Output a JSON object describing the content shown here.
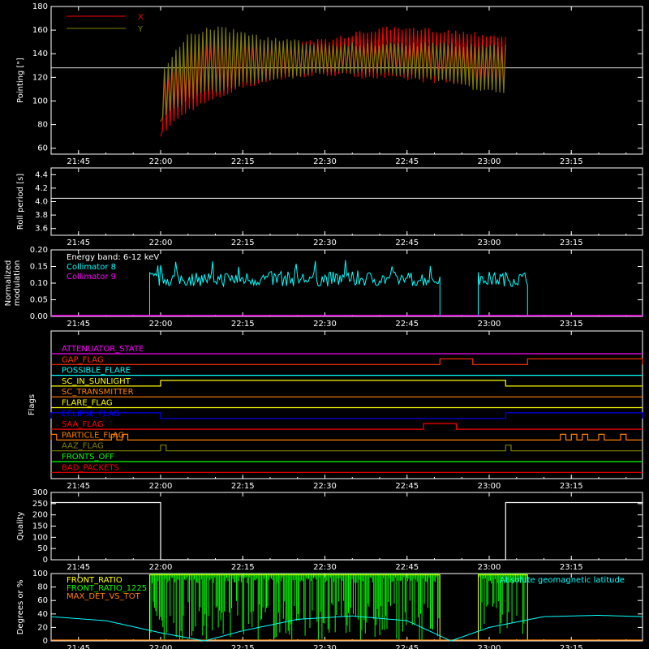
{
  "colors": {
    "background": "#000000",
    "axes": "#ffffff",
    "x_pointing": "#ff0000",
    "y_pointing": "#808000",
    "collimator_8": "#00ffff",
    "collimator_9": "#ff00ff",
    "front_ratio": "#ffff00",
    "front_ratio_1225": "#00ff00",
    "max_det_vs_tot": "#ff8000",
    "geomagnetic_latitude": "#00ffff"
  },
  "time_axis": {
    "range": [
      "21:40",
      "23:28"
    ],
    "tick_labels": [
      "21:45",
      "22:00",
      "22:15",
      "22:30",
      "22:45",
      "23:00",
      "23:15"
    ]
  },
  "chart_data": [
    {
      "id": "pointing",
      "type": "line",
      "xlabel": "",
      "ylabel": "Pointing [\"]",
      "ylim": [
        55,
        180
      ],
      "yticks": [
        60,
        80,
        100,
        120,
        140,
        160,
        180
      ],
      "legend": {
        "position": "top-left",
        "entries": [
          "X",
          "Y"
        ]
      },
      "reference_line": 128,
      "series": [
        {
          "name": "X",
          "color": "#ff0000",
          "x": [
            "22:00",
            "22:05",
            "22:10",
            "22:15",
            "22:20",
            "22:30",
            "22:40",
            "22:50",
            "23:00",
            "23:03"
          ],
          "upper": [
            120,
            150,
            158,
            155,
            152,
            153,
            163,
            162,
            158,
            156
          ],
          "lower": [
            70,
            90,
            100,
            110,
            116,
            121,
            118,
            115,
            110,
            107
          ]
        },
        {
          "name": "Y",
          "color": "#808000",
          "x": [
            "22:00",
            "22:05",
            "22:10",
            "22:15",
            "22:20",
            "22:30",
            "22:40",
            "22:50",
            "23:00",
            "23:03"
          ],
          "upper": [
            125,
            158,
            164,
            160,
            154,
            150,
            150,
            150,
            148,
            148
          ],
          "lower": [
            82,
            100,
            107,
            112,
            117,
            122,
            121,
            117,
            106,
            103
          ]
        }
      ]
    },
    {
      "id": "roll_period",
      "type": "line",
      "xlabel": "",
      "ylabel": "Roll period [s]",
      "ylim": [
        3.5,
        4.5
      ],
      "yticks": [
        "3.6",
        "3.8",
        "4.0",
        "4.2",
        "4.4"
      ],
      "series": [
        {
          "x": [
            "21:40",
            "23:28"
          ],
          "y": [
            4.05,
            4.05
          ]
        }
      ]
    },
    {
      "id": "modulation",
      "type": "line",
      "xlabel": "",
      "ylabel": "Normalized modulation",
      "ylim": [
        0,
        0.2
      ],
      "yticks": [
        "0.00",
        "0.05",
        "0.10",
        "0.15",
        "0.20"
      ],
      "legend": {
        "position": "top-left",
        "entries": [
          "Energy band: 6-12 keV",
          "Collimator 8",
          "Collimator 9"
        ]
      },
      "series": [
        {
          "name": "Collimator 8",
          "color": "#00ffff",
          "segments": [
            {
              "start": "21:58",
              "end": "22:51",
              "mean": 0.11
            },
            {
              "start": "22:58",
              "end": "23:07",
              "mean": 0.11
            }
          ]
        },
        {
          "name": "Collimator 9",
          "color": "#ff00ff",
          "x": [
            "21:40",
            "23:28"
          ],
          "y": [
            0,
            0
          ]
        }
      ]
    },
    {
      "id": "flags",
      "type": "line",
      "xlabel": "",
      "ylabel": "Flags",
      "series": [
        {
          "name": "ATTENUATOR_STATE",
          "color": "#ff00ff",
          "on": []
        },
        {
          "name": "GAP_FLAG",
          "color": "#ff3000",
          "on": [
            [
              "22:51",
              "22:57"
            ],
            [
              "23:07",
              "23:28"
            ]
          ]
        },
        {
          "name": "POSSIBLE_FLARE",
          "color": "#00ffff",
          "on": []
        },
        {
          "name": "SC_IN_SUNLIGHT",
          "color": "#ffff00",
          "on": [
            [
              "22:00",
              "23:03"
            ]
          ]
        },
        {
          "name": "SC_TRANSMITTER",
          "color": "#ff8000",
          "on": []
        },
        {
          "name": "FLARE_FLAG",
          "color": "#ffff00",
          "on": []
        },
        {
          "name": "ECLIPSE_FLAG",
          "color": "#0000ff",
          "on": [
            [
              "21:40",
              "22:00"
            ],
            [
              "23:03",
              "23:28"
            ]
          ]
        },
        {
          "name": "SAA_FLAG",
          "color": "#ff0000",
          "on": [
            [
              "22:48",
              "22:54"
            ]
          ]
        },
        {
          "name": "PARTICLE_FLAG",
          "color": "#ff8000",
          "on": [
            [
              "21:40",
              "21:41"
            ],
            [
              "21:51",
              "21:52"
            ],
            [
              "21:53",
              "21:54"
            ],
            [
              "23:13",
              "23:14"
            ],
            [
              "23:15",
              "23:16"
            ],
            [
              "23:17",
              "23:18"
            ],
            [
              "23:20",
              "23:21"
            ],
            [
              "23:24",
              "23:25"
            ]
          ]
        },
        {
          "name": "AAZ_FLAG",
          "color": "#808000",
          "on": [
            [
              "22:00",
              "22:01"
            ],
            [
              "23:03",
              "23:04"
            ]
          ]
        },
        {
          "name": "FRONTS_OFF",
          "color": "#00ff00",
          "on": []
        },
        {
          "name": "BAD_PACKETS",
          "color": "#ff0000",
          "on": []
        }
      ]
    },
    {
      "id": "quality",
      "type": "line",
      "xlabel": "",
      "ylabel": "Quality",
      "ylim": [
        0,
        300
      ],
      "yticks": [
        0,
        50,
        100,
        150,
        200,
        250,
        300
      ],
      "series": [
        {
          "x": [
            "21:40",
            "22:00",
            "22:00",
            "23:03",
            "23:03",
            "23:28"
          ],
          "y": [
            255,
            255,
            0,
            0,
            255,
            255
          ]
        }
      ]
    },
    {
      "id": "ratios",
      "type": "line",
      "xlabel": "",
      "ylabel": "Degrees or %",
      "ylim": [
        0,
        100
      ],
      "yticks": [
        0,
        20,
        40,
        60,
        80,
        100
      ],
      "legend": {
        "position": "top",
        "entries": [
          "FRONT_RATIO",
          "FRONT_RATIO_1225",
          "MAX_DET_VS_TOT",
          "Absolute geomagnetic latitude"
        ]
      },
      "series": [
        {
          "name": "FRONT_RATIO",
          "color": "#ffff00",
          "on": [
            [
              "21:58",
              "22:51"
            ],
            [
              "22:58",
              "23:07"
            ]
          ],
          "value": 98
        },
        {
          "name": "FRONT_RATIO_1225",
          "color": "#00ff00",
          "on": [
            [
              "21:58",
              "22:51"
            ],
            [
              "22:58",
              "23:07"
            ]
          ],
          "value": 100
        },
        {
          "name": "MAX_DET_VS_TOT",
          "color": "#ff8000",
          "x": [
            "21:40",
            "23:28"
          ],
          "y": [
            0,
            0
          ]
        },
        {
          "name": "Absolute geomagnetic latitude",
          "color": "#00ffff",
          "x": [
            "21:40",
            "21:50",
            "22:00",
            "22:08",
            "22:15",
            "22:25",
            "22:35",
            "22:45",
            "22:53",
            "23:00",
            "23:10",
            "23:20",
            "23:28"
          ],
          "y": [
            36,
            30,
            12,
            0,
            15,
            32,
            37,
            30,
            0,
            20,
            36,
            38,
            36
          ]
        }
      ]
    }
  ]
}
